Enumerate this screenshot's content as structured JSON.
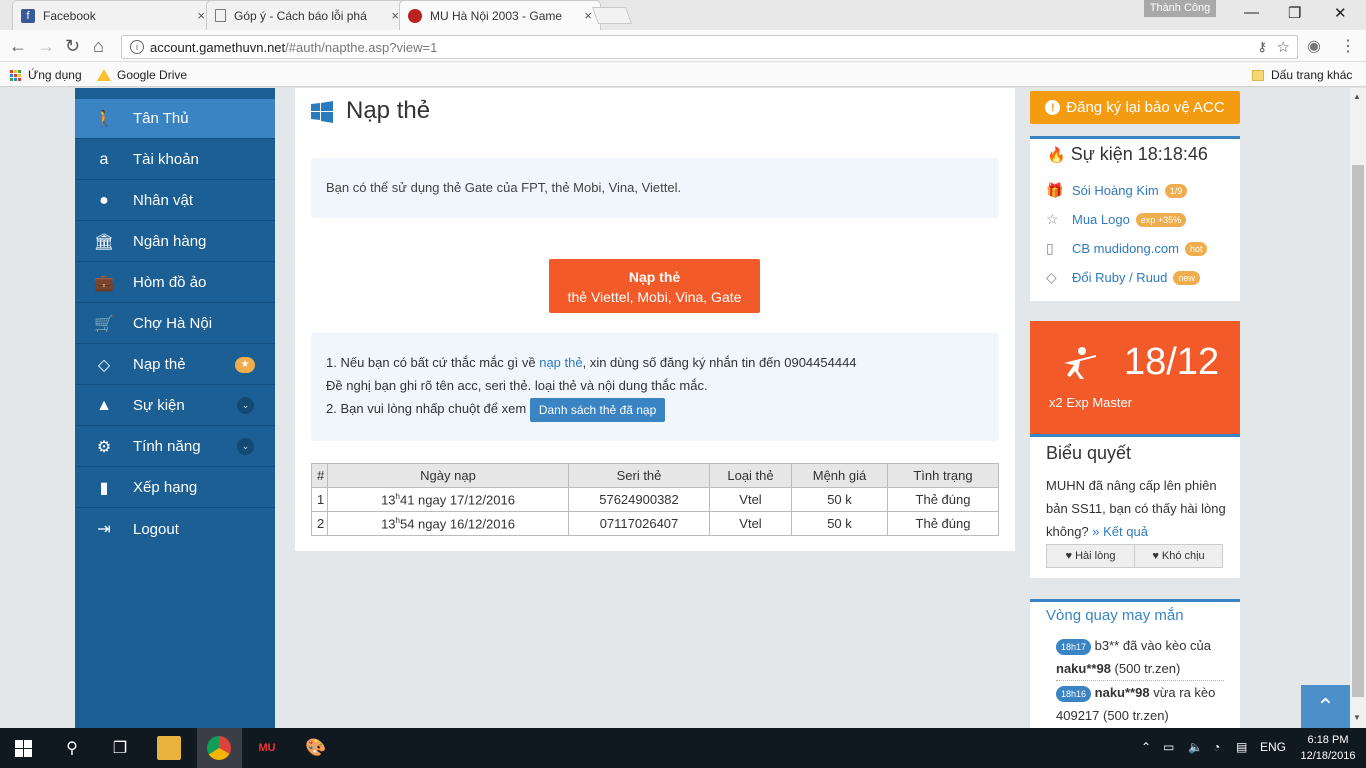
{
  "tabs": [
    {
      "title": "Facebook",
      "close": "×"
    },
    {
      "title": "Góp ý - Cách báo lỗi phá",
      "close": "×"
    },
    {
      "title": "MU Hà Nội 2003 - Game",
      "close": "×"
    }
  ],
  "profile_name": "Thành Công",
  "window_controls": {
    "minimize": "—",
    "maximize": "❐",
    "close": "✕"
  },
  "address": {
    "host": "account.gamethuvn.net",
    "path": "/#auth/napthe.asp?view=1"
  },
  "bookmarks": {
    "apps": "Ứng dụng",
    "drive": "Google Drive",
    "other": "Dấu trang khác"
  },
  "sidebar": {
    "items": [
      {
        "label": "Tân Thủ",
        "icon": "person-walking-icon"
      },
      {
        "label": "Tài khoản",
        "icon": "amazon-icon"
      },
      {
        "label": "Nhân vật",
        "icon": "user-icon"
      },
      {
        "label": "Ngân hàng",
        "icon": "bank-icon"
      },
      {
        "label": "Hòm đồ ảo",
        "icon": "briefcase-icon"
      },
      {
        "label": "Chợ Hà Nội",
        "icon": "cart-icon"
      },
      {
        "label": "Nạp thẻ",
        "icon": "diamond-icon",
        "badge": "★"
      },
      {
        "label": "Sự kiện",
        "icon": "android-icon",
        "chevron": "⌄"
      },
      {
        "label": "Tính năng",
        "icon": "gears-icon",
        "chevron": "⌄"
      },
      {
        "label": "Xếp hạng",
        "icon": "bar-chart-icon"
      },
      {
        "label": "Logout",
        "icon": "sign-out-icon"
      }
    ]
  },
  "main": {
    "title": "Nạp thẻ",
    "notice": "Bạn có thể sử dụng thẻ Gate của FPT, thẻ Mobi, Vina, Viettel.",
    "nap_button": {
      "line1": "Nạp thẻ",
      "line2": "thẻ Viettel, Mobi, Vina, Gate"
    },
    "info": {
      "l1_pre": "1. Nếu bạn có bất cứ thắc mắc gì về ",
      "l1_link": "nạp thẻ",
      "l1_post": ", xin dùng số đăng ký nhắn tin đến 0904454444",
      "l2": "Đề nghị bạn ghi rõ tên acc, seri thẻ. loại thẻ và nội dung thắc mắc.",
      "l3": "2. Bạn vui lòng nhấp chuột để xem",
      "list_button": "Danh sách thẻ đã nạp"
    },
    "table": {
      "headers": [
        "#",
        "Ngày nạp",
        "Seri thẻ",
        "Loại thẻ",
        "Mệnh giá",
        "Tình trạng"
      ],
      "rows": [
        {
          "n": "1",
          "hour": "13",
          "sup": "h",
          "rest": "41 ngay 17/12/2016",
          "seri": "57624900382",
          "type": "Vtel",
          "value": "50 k",
          "status": "Thẻ đúng"
        },
        {
          "n": "2",
          "hour": "13",
          "sup": "h",
          "rest": "54 ngay 16/12/2016",
          "seri": "07117026407",
          "type": "Vtel",
          "value": "50 k",
          "status": "Thẻ đúng"
        }
      ]
    }
  },
  "right": {
    "reg_button": "Đăng ký lại bảo vệ ACC",
    "event_title": "Sự kiện 18:18:46",
    "events": [
      {
        "label": "Sói Hoàng Kim",
        "tag": "1/9"
      },
      {
        "label": "Mua Logo",
        "tag": "exp +35%"
      },
      {
        "label": "CB mudidong.com",
        "tag": "hot"
      },
      {
        "label": "Đổi Ruby / Ruud",
        "tag": "new"
      }
    ],
    "promo": {
      "date": "18/12",
      "text": "x2 Exp Master"
    },
    "poll": {
      "title": "Biểu quyết",
      "question": "MUHN đã nâng cấp lên phiên bản SS11, bạn có thấy hài lòng không?",
      "result_link": "» Kết quả",
      "yes": "Hài lòng",
      "no": "Khó chịu"
    },
    "wheel": {
      "title": "Vòng quay may mắn",
      "entries": [
        {
          "time": "18h17",
          "user": "b3**",
          "mid": " đã vào kèo của ",
          "user2": "naku**98",
          "amt": "(500 tr.zen)"
        },
        {
          "time": "18h16",
          "user": "naku**98",
          "mid": " vừa ra kèo 409217 ",
          "user2": "",
          "amt": "(500 tr.zen)"
        }
      ]
    }
  },
  "taskbar": {
    "lang": "ENG",
    "time": "6:18 PM",
    "date": "12/18/2016"
  }
}
